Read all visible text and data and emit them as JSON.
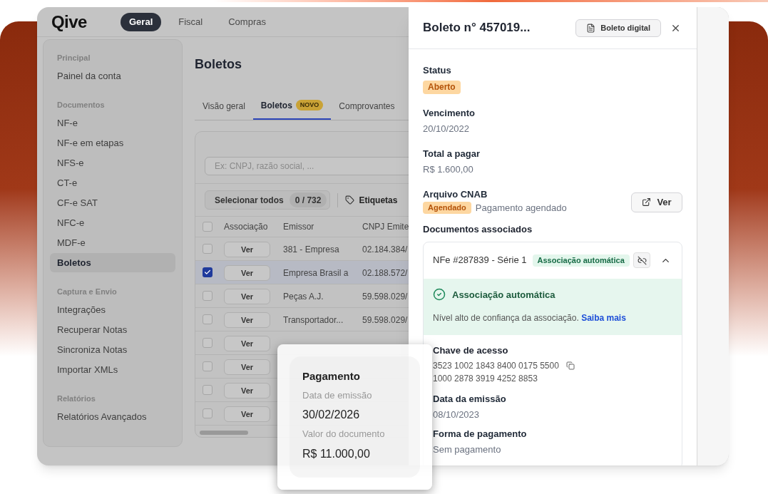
{
  "app": {
    "logo": "Qive",
    "nav_tabs": [
      {
        "label": "Geral",
        "selected": true
      },
      {
        "label": "Fiscal",
        "selected": false
      },
      {
        "label": "Compras",
        "selected": false
      }
    ],
    "sidebar": {
      "sections": [
        {
          "title": "Principal",
          "items": [
            {
              "label": "Painel da conta",
              "selected": false
            }
          ]
        },
        {
          "title": "Documentos",
          "items": [
            {
              "label": "NF-e",
              "selected": false
            },
            {
              "label": "NF-e em etapas",
              "selected": false
            },
            {
              "label": "NFS-e",
              "selected": false
            },
            {
              "label": "CT-e",
              "selected": false
            },
            {
              "label": "CF-e SAT",
              "selected": false
            },
            {
              "label": "NFC-e",
              "selected": false
            },
            {
              "label": "MDF-e",
              "selected": false
            },
            {
              "label": "Boletos",
              "selected": true
            }
          ]
        },
        {
          "title": "Captura e Envio",
          "items": [
            {
              "label": "Integrações",
              "selected": false
            },
            {
              "label": "Recuperar Notas",
              "selected": false
            },
            {
              "label": "Sincroniza Notas",
              "selected": false
            },
            {
              "label": "Importar XMLs",
              "selected": false
            }
          ]
        },
        {
          "title": "Relatórios",
          "items": [
            {
              "label": "Relatórios Avançados",
              "selected": false
            }
          ]
        }
      ]
    },
    "page_title": "Boletos",
    "tabs": [
      {
        "label": "Visão geral",
        "selected": false
      },
      {
        "label": "Boletos",
        "selected": true,
        "badge": "NOVO"
      },
      {
        "label": "Comprovantes",
        "selected": false
      }
    ],
    "search": {
      "placeholder": "Ex: CNPJ, razão social, ..."
    },
    "toolbar": {
      "select_all": "Selecionar todos",
      "count": "0 / 732",
      "tags": "Etiquetas"
    },
    "table": {
      "header_checked": false,
      "columns": [
        "Associação",
        "Emissor",
        "CNPJ Emite"
      ],
      "rows": [
        {
          "checked": false,
          "action": "Ver",
          "emissor": "381 - Empresa",
          "cnpj": "02.184.384/"
        },
        {
          "checked": true,
          "action": "Ver",
          "emissor": "Empresa Brasil a",
          "cnpj": "02.188.572/"
        },
        {
          "checked": false,
          "action": "Ver",
          "emissor": "Peças A.J.",
          "cnpj": "59.598.029/"
        },
        {
          "checked": false,
          "action": "Ver",
          "emissor": "Transportador...",
          "cnpj": "59.598.029/"
        },
        {
          "checked": false,
          "action": "Ver"
        },
        {
          "checked": false,
          "action": "Ver"
        },
        {
          "checked": false,
          "action": "Ver"
        },
        {
          "checked": false,
          "action": "Ver"
        }
      ]
    }
  },
  "drawer": {
    "title": "Boleto n° 457019...",
    "digital_button": "Boleto digital",
    "status": {
      "label": "Status",
      "badge": "Aberto"
    },
    "due": {
      "label": "Vencimento",
      "value": "20/10/2022"
    },
    "total": {
      "label": "Total a pagar",
      "value": "R$ 1.600,00"
    },
    "cnab": {
      "label": "Arquivo CNAB",
      "badge": "Agendado",
      "text": "Pagamento agendado",
      "button": "Ver"
    },
    "documents": {
      "label": "Documentos associados",
      "document": {
        "title": "NFe #287839 - Série 1",
        "badge": "Associação automática",
        "expanded": true,
        "notice": {
          "title": "Associação automática",
          "text": "Nível alto de confiança da associação.",
          "link": "Saiba mais"
        },
        "key": {
          "label": "Chave de acesso",
          "lines": [
            "3523 1002 1843 8400 0175 5500",
            "1000 2878 3919 4252 8853"
          ]
        },
        "issue_date": {
          "label": "Data da emissão",
          "value": "08/10/2023"
        },
        "payment": {
          "label": "Forma de pagamento",
          "value": "Sem pagamento"
        }
      }
    }
  },
  "popup": {
    "title": "Pagamento",
    "fields": [
      {
        "label": "Data de emissão",
        "value": "30/02/2026"
      },
      {
        "label": "Valor do documento",
        "value": "R$ 11.000,00"
      }
    ]
  }
}
